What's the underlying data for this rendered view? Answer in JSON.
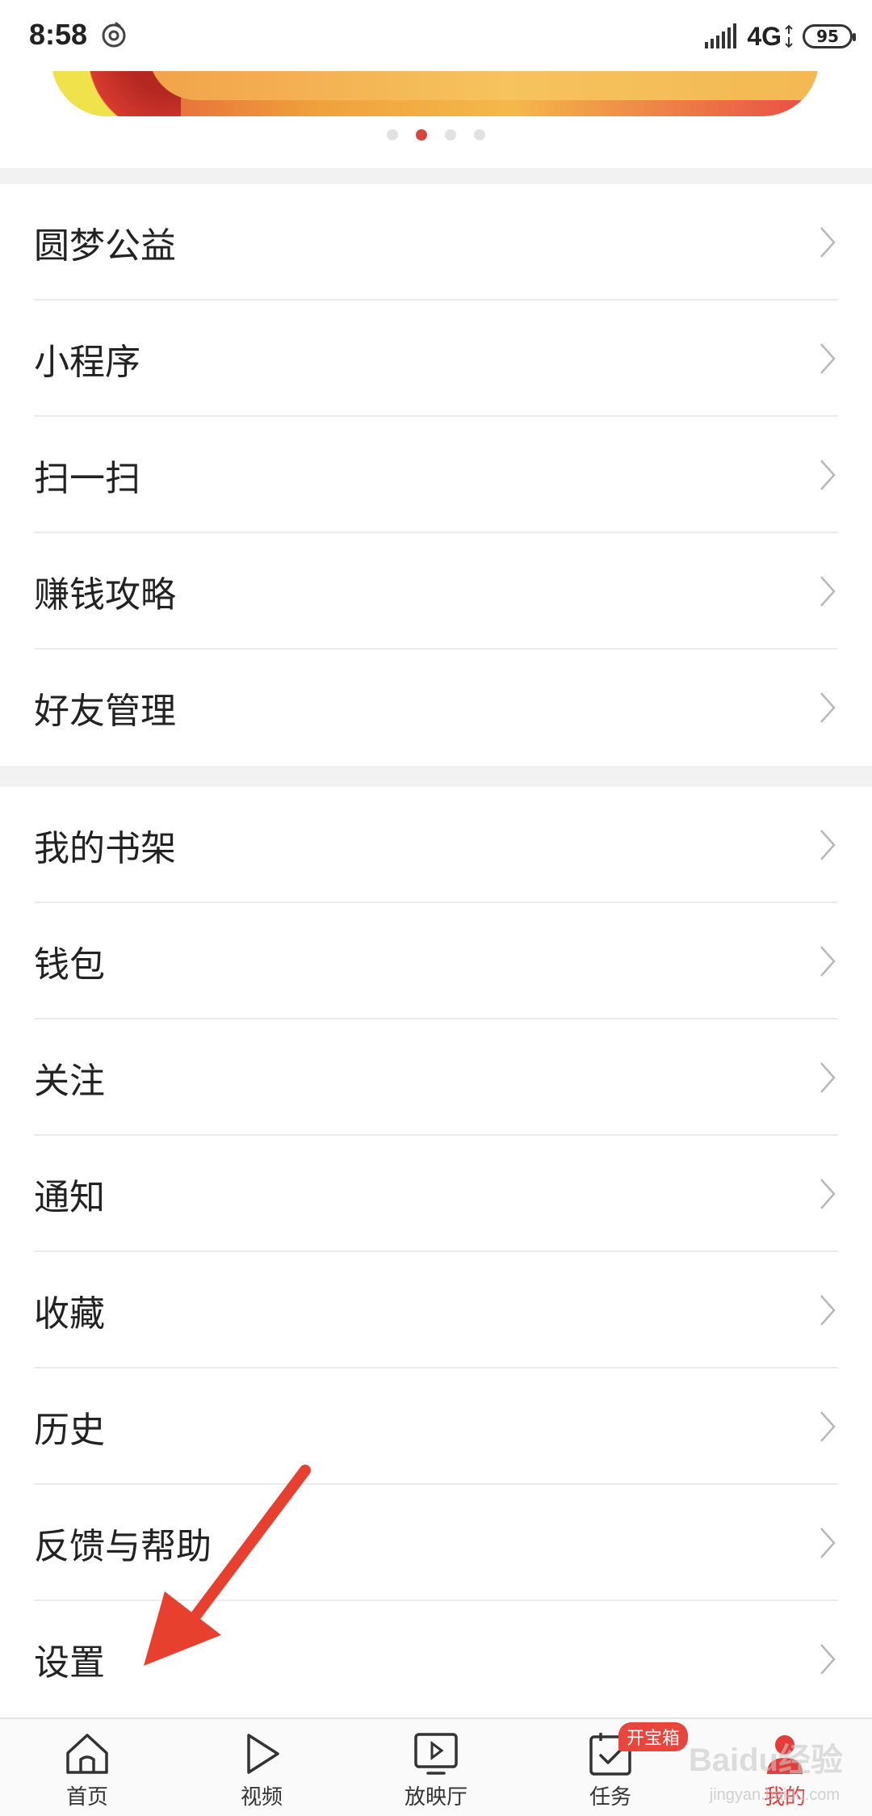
{
  "status_bar": {
    "time": "8:58",
    "network": "4G",
    "battery": "95"
  },
  "banner": {
    "dots_count": 4,
    "active_dot": 1
  },
  "menu_group_1": [
    {
      "label": "圆梦公益"
    },
    {
      "label": "小程序"
    },
    {
      "label": "扫一扫"
    },
    {
      "label": "赚钱攻略"
    },
    {
      "label": "好友管理"
    }
  ],
  "menu_group_2": [
    {
      "label": "我的书架"
    },
    {
      "label": "钱包"
    },
    {
      "label": "关注"
    },
    {
      "label": "通知"
    },
    {
      "label": "收藏"
    },
    {
      "label": "历史"
    },
    {
      "label": "反馈与帮助"
    },
    {
      "label": "设置"
    }
  ],
  "bottom_nav": {
    "items": [
      {
        "label": "首页",
        "icon": "home-icon"
      },
      {
        "label": "视频",
        "icon": "play-icon"
      },
      {
        "label": "放映厅",
        "icon": "tv-play-icon"
      },
      {
        "label": "任务",
        "icon": "task-check-icon",
        "badge": "开宝箱"
      },
      {
        "label": "我的",
        "icon": "user-icon",
        "active": true
      }
    ]
  },
  "watermark": {
    "text": "Baidu经验",
    "sub": "jingyan.baidu.com"
  },
  "colors": {
    "accent": "#e63b3b",
    "badge": "#e8453c",
    "annotation": "#e8402f"
  }
}
